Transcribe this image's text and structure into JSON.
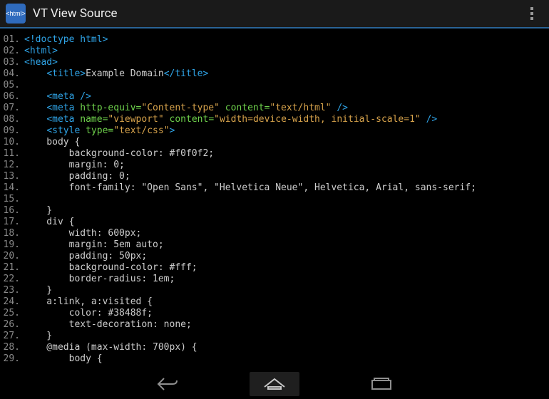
{
  "app": {
    "title": "VT View Source",
    "icon_label": "<html>"
  },
  "code": {
    "lines": [
      {
        "n": "01.",
        "segs": [
          [
            "doct",
            "<!doctype html>"
          ]
        ]
      },
      {
        "n": "02.",
        "segs": [
          [
            "tag",
            "<html>"
          ]
        ]
      },
      {
        "n": "03.",
        "segs": [
          [
            "tag",
            "<head>"
          ]
        ]
      },
      {
        "n": "04.",
        "segs": [
          [
            "plain",
            "    "
          ],
          [
            "tag",
            "<title>"
          ],
          [
            "plain",
            "Example Domain"
          ],
          [
            "tag",
            "</title>"
          ]
        ]
      },
      {
        "n": "05.",
        "segs": []
      },
      {
        "n": "06.",
        "segs": [
          [
            "plain",
            "    "
          ],
          [
            "tag",
            "<meta />"
          ]
        ]
      },
      {
        "n": "07.",
        "segs": [
          [
            "plain",
            "    "
          ],
          [
            "tag",
            "<meta "
          ],
          [
            "attr",
            "http-equiv="
          ],
          [
            "str",
            "\"Content-type\""
          ],
          [
            "attr",
            " content="
          ],
          [
            "str",
            "\"text/html\""
          ],
          [
            "tag",
            " />"
          ]
        ]
      },
      {
        "n": "08.",
        "segs": [
          [
            "plain",
            "    "
          ],
          [
            "tag",
            "<meta "
          ],
          [
            "attr",
            "name="
          ],
          [
            "str",
            "\"viewport\""
          ],
          [
            "attr",
            " content="
          ],
          [
            "str",
            "\"width=device-width, initial-scale=1\""
          ],
          [
            "tag",
            " />"
          ]
        ]
      },
      {
        "n": "09.",
        "segs": [
          [
            "plain",
            "    "
          ],
          [
            "tag",
            "<style "
          ],
          [
            "attr",
            "type="
          ],
          [
            "str",
            "\"text/css\""
          ],
          [
            "tag",
            ">"
          ]
        ]
      },
      {
        "n": "10.",
        "segs": [
          [
            "plain",
            "    body {"
          ]
        ]
      },
      {
        "n": "11.",
        "segs": [
          [
            "plain",
            "        background-color: #f0f0f2;"
          ]
        ]
      },
      {
        "n": "12.",
        "segs": [
          [
            "plain",
            "        margin: 0;"
          ]
        ]
      },
      {
        "n": "13.",
        "segs": [
          [
            "plain",
            "        padding: 0;"
          ]
        ]
      },
      {
        "n": "14.",
        "segs": [
          [
            "plain",
            "        font-family: \"Open Sans\", \"Helvetica Neue\", Helvetica, Arial, sans-serif;"
          ]
        ]
      },
      {
        "n": "15.",
        "segs": [
          [
            "plain",
            "        "
          ]
        ]
      },
      {
        "n": "16.",
        "segs": [
          [
            "plain",
            "    }"
          ]
        ]
      },
      {
        "n": "17.",
        "segs": [
          [
            "plain",
            "    div {"
          ]
        ]
      },
      {
        "n": "18.",
        "segs": [
          [
            "plain",
            "        width: 600px;"
          ]
        ]
      },
      {
        "n": "19.",
        "segs": [
          [
            "plain",
            "        margin: 5em auto;"
          ]
        ]
      },
      {
        "n": "20.",
        "segs": [
          [
            "plain",
            "        padding: 50px;"
          ]
        ]
      },
      {
        "n": "21.",
        "segs": [
          [
            "plain",
            "        background-color: #fff;"
          ]
        ]
      },
      {
        "n": "22.",
        "segs": [
          [
            "plain",
            "        border-radius: 1em;"
          ]
        ]
      },
      {
        "n": "23.",
        "segs": [
          [
            "plain",
            "    }"
          ]
        ]
      },
      {
        "n": "24.",
        "segs": [
          [
            "plain",
            "    a:link, a:visited {"
          ]
        ]
      },
      {
        "n": "25.",
        "segs": [
          [
            "plain",
            "        color: #38488f;"
          ]
        ]
      },
      {
        "n": "26.",
        "segs": [
          [
            "plain",
            "        text-decoration: none;"
          ]
        ]
      },
      {
        "n": "27.",
        "segs": [
          [
            "plain",
            "    }"
          ]
        ]
      },
      {
        "n": "28.",
        "segs": [
          [
            "plain",
            "    @media (max-width: 700px) {"
          ]
        ]
      },
      {
        "n": "29.",
        "segs": [
          [
            "plain",
            "        body {"
          ]
        ]
      }
    ]
  },
  "nav": {
    "back": "back-icon",
    "home": "home-icon",
    "recents": "recents-icon"
  }
}
